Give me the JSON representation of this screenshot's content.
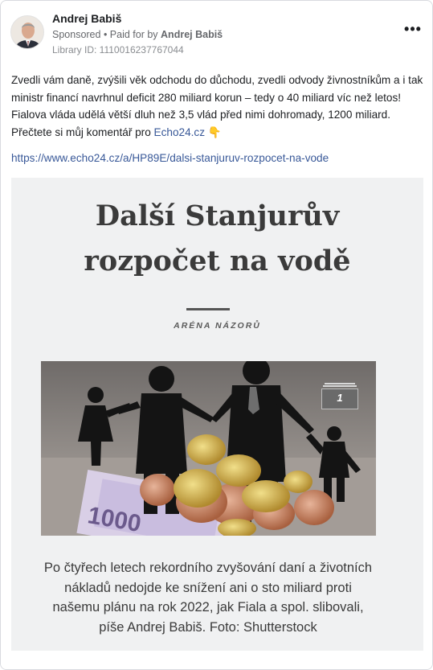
{
  "post": {
    "author": "Andrej Babiš",
    "sponsored": "Sponsored",
    "paid_for_prefix": " • Paid for by ",
    "paid_for_by": "Andrej Babiš",
    "library_id": "Library ID: 1110016237767044",
    "more_label": "•••",
    "text": "Zvedli vám daně, zvýšili věk odchodu do důchodu, zvedli odvody živnostníkům a i tak ministr financí navrhnul deficit 280 miliard korun – tedy o 40 miliard víc než letos! Fialova vláda udělá větší dluh než 3,5 vlád před nimi dohromady, 1200 miliard. Přečtete si můj komentář pro ",
    "text_link": "Echo24.cz",
    "emoji": "👇",
    "url": "https://www.echo24.cz/a/HP89E/dalsi-stanjuruv-rozpocet-na-vode"
  },
  "preview": {
    "headline_line1": "Další Stanjurův",
    "headline_line2": "rozpočet na vodě",
    "section": "ARÉNA NÁZORŮ",
    "gallery_count": "1",
    "caption": "Po čtyřech letech rekordního zvyšování daní a životních nákladů nedojde ke snížení ani o sto miliard proti našemu plánu na rok 2022, jak Fiala a spol. slibovali, píše Andrej Babiš. Foto: Shutterstock",
    "banknote_text": "1000"
  },
  "colors": {
    "link": "#385898",
    "meta": "#65676b",
    "preview_bg": "#f0f1f2"
  }
}
